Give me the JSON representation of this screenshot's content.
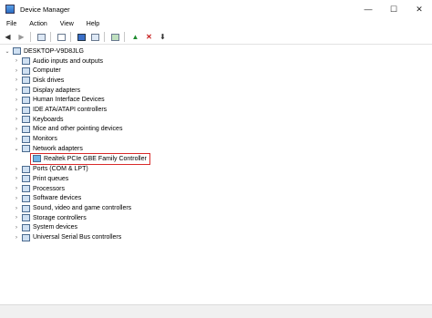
{
  "window": {
    "title": "Device Manager",
    "minimize": "—",
    "maximize": "☐",
    "close": "✕"
  },
  "menu": [
    "File",
    "Action",
    "View",
    "Help"
  ],
  "tree": {
    "root": "DESKTOP-V9D8JLG",
    "items": [
      {
        "label": "Audio inputs and outputs",
        "icon": "speaker-icon",
        "expanded": false
      },
      {
        "label": "Computer",
        "icon": "monitor-icon",
        "expanded": false
      },
      {
        "label": "Disk drives",
        "icon": "disk-icon",
        "expanded": false
      },
      {
        "label": "Display adapters",
        "icon": "display-adapter-icon",
        "expanded": false
      },
      {
        "label": "Human Interface Devices",
        "icon": "hid-icon",
        "expanded": false
      },
      {
        "label": "IDE ATA/ATAPI controllers",
        "icon": "ide-controller-icon",
        "expanded": false
      },
      {
        "label": "Keyboards",
        "icon": "keyboard-icon",
        "expanded": false
      },
      {
        "label": "Mice and other pointing devices",
        "icon": "mouse-icon",
        "expanded": false
      },
      {
        "label": "Monitors",
        "icon": "monitor-icon",
        "expanded": false
      },
      {
        "label": "Network adapters",
        "icon": "network-icon",
        "expanded": true,
        "children": [
          {
            "label": "Realtek PCIe GBE Family Controller",
            "icon": "network-icon",
            "selected": true
          }
        ]
      },
      {
        "label": "Ports (COM & LPT)",
        "icon": "port-icon",
        "expanded": false
      },
      {
        "label": "Print queues",
        "icon": "printer-icon",
        "expanded": false
      },
      {
        "label": "Processors",
        "icon": "processor-icon",
        "expanded": false
      },
      {
        "label": "Software devices",
        "icon": "software-device-icon",
        "expanded": false
      },
      {
        "label": "Sound, video and game controllers",
        "icon": "sound-icon",
        "expanded": false
      },
      {
        "label": "Storage controllers",
        "icon": "storage-icon",
        "expanded": false
      },
      {
        "label": "System devices",
        "icon": "system-device-icon",
        "expanded": false
      },
      {
        "label": "Universal Serial Bus controllers",
        "icon": "usb-icon",
        "expanded": false
      }
    ]
  },
  "colors": {
    "selection_border": "#d92b2b",
    "accent": "#2b6cc4"
  }
}
